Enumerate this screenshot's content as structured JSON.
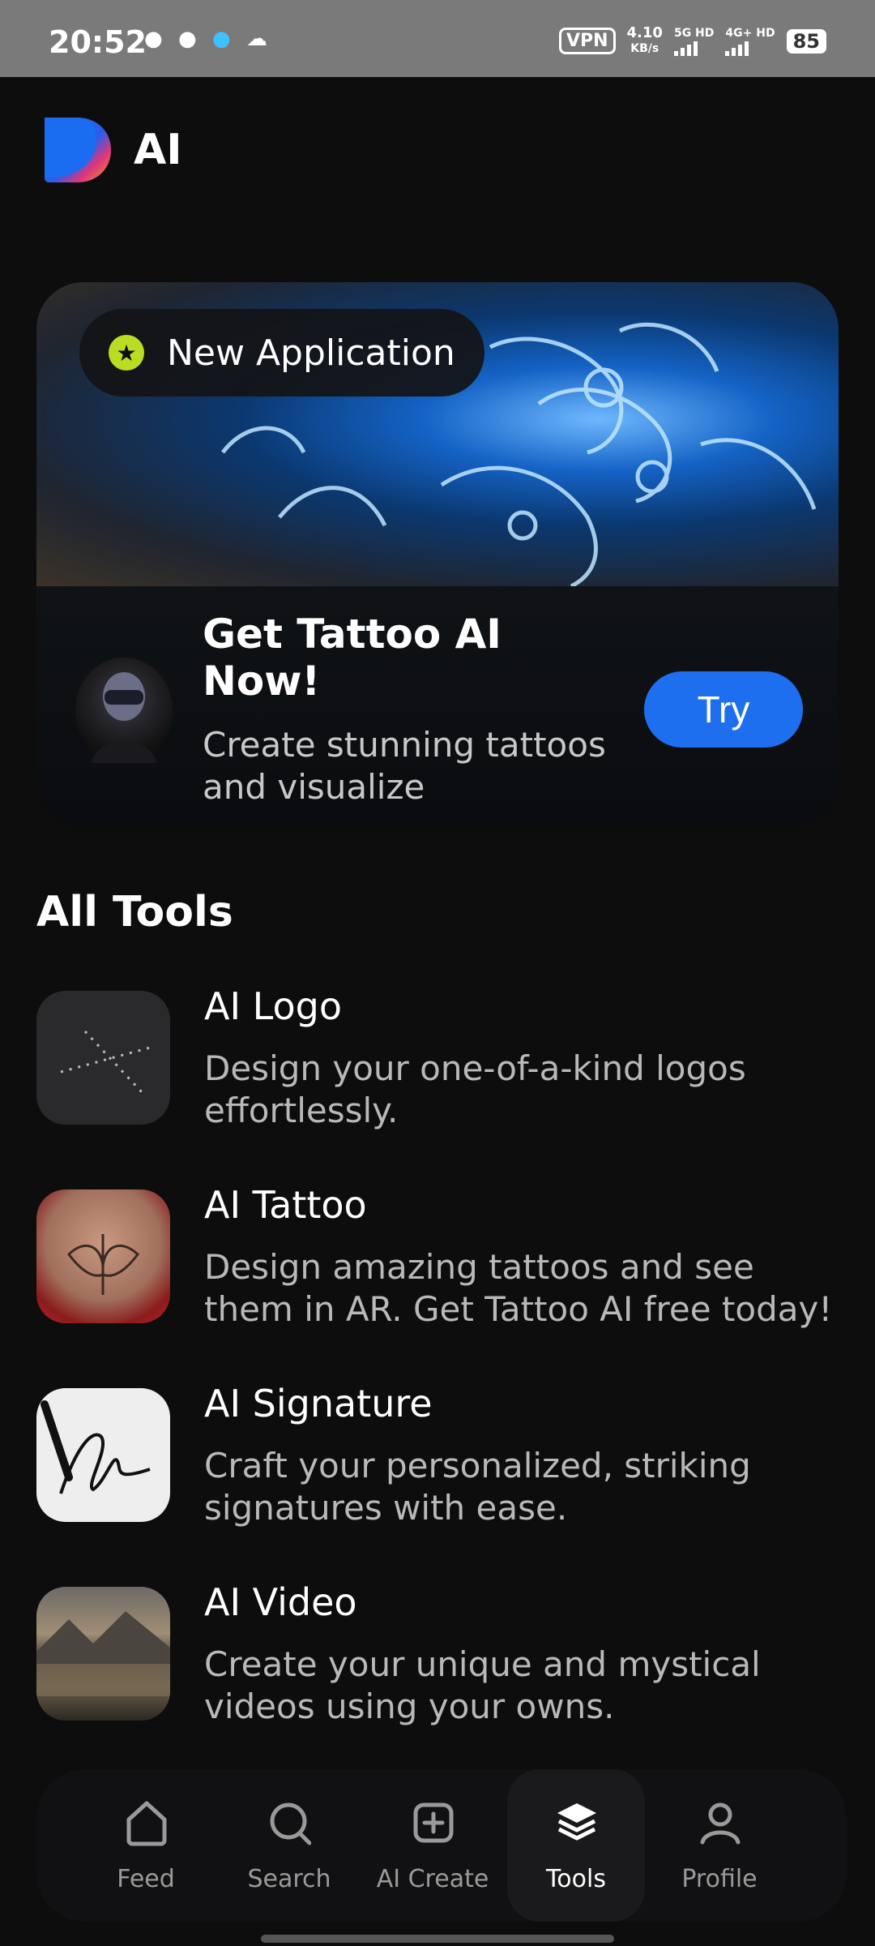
{
  "status_bar": {
    "time": "20:52",
    "vpn": "VPN",
    "speed_value": "4.10",
    "speed_unit": "KB/s",
    "net1": "5G HD",
    "net2": "4G+ HD",
    "battery": "85"
  },
  "header": {
    "title": "AI"
  },
  "banner": {
    "badge": "New Application",
    "heading": "Get Tattoo AI Now!",
    "subtitle": "Create stunning tattoos and visualize",
    "button": "Try"
  },
  "tools": {
    "title": "All Tools",
    "items": [
      {
        "name": "AI Logo",
        "description": "Design your one-of-a-kind logos effortlessly."
      },
      {
        "name": "AI Tattoo",
        "description": "Design amazing tattoos and see them in AR. Get Tattoo AI free today!"
      },
      {
        "name": "AI Signature",
        "description": "Craft your personalized, striking signatures with ease."
      },
      {
        "name": "AI Video",
        "description": "Create your unique and mystical videos using your owns."
      }
    ]
  },
  "nav": {
    "items": [
      {
        "label": "Feed",
        "icon": "home-icon"
      },
      {
        "label": "Search",
        "icon": "search-icon"
      },
      {
        "label": "AI Create",
        "icon": "plus-square-icon"
      },
      {
        "label": "Tools",
        "icon": "layers-icon",
        "active": true
      },
      {
        "label": "Profile",
        "icon": "person-icon"
      }
    ]
  },
  "colors": {
    "accent": "#1d6ff0",
    "badge_star": "#b8dd22",
    "background": "#0d0d0e"
  }
}
